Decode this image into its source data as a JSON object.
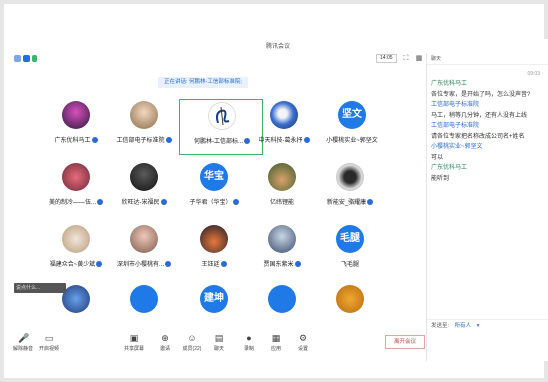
{
  "window": {
    "title": "腾讯会议"
  },
  "topbar": {
    "time": "14:05"
  },
  "speaker": {
    "text": "正在讲话: 何鹏林-工信部标准院;"
  },
  "participants": [
    {
      "name": "广东优科马工",
      "avatar": "photo-tower"
    },
    {
      "name": "工信部电子标准院",
      "avatar": "photo-child"
    },
    {
      "name": "何鹏林-工信部标...",
      "avatar": "photo-logo"
    },
    {
      "name": "中天科技-葛永抒",
      "avatar": "photo-earth"
    },
    {
      "name": "小樱桃实业~郭坚文",
      "avatar_text": "坚文"
    },
    {
      "name": "美的制冷——伍...",
      "avatar": "photo-floral"
    },
    {
      "name": "欣旺达-宋福民",
      "avatar": "photo-dark"
    },
    {
      "name": "子华君（华宝）",
      "avatar_text": "华宝"
    },
    {
      "name": "亿纬锂能",
      "avatar": "photo-landscape"
    },
    {
      "name": "新能安_骆耀康",
      "avatar": "photo-cup"
    },
    {
      "name": "福建众合~黄少斌",
      "avatar": "photo-cartoon"
    },
    {
      "name": "深圳市小樱桃有...",
      "avatar": "photo-girl"
    },
    {
      "name": "王钰廷",
      "avatar": "photo-city"
    },
    {
      "name": "贾国东紫米",
      "avatar": "photo-man"
    },
    {
      "name": "飞毛腿",
      "avatar_text": "毛腿"
    },
    {
      "name": "",
      "avatar": "photo-blue"
    },
    {
      "name": "",
      "avatar": "photo-plain"
    },
    {
      "name": "",
      "avatar_text": "建坤"
    },
    {
      "name": "",
      "avatar": "photo-plain2"
    },
    {
      "name": "",
      "avatar": "photo-orange"
    }
  ],
  "self_bar": {
    "text": "说点什么..."
  },
  "chat": {
    "title": "聊天",
    "time": "09:03",
    "messages": [
      {
        "sender": "广东优科马工",
        "text": "各位专家，是开始了吗，怎么没声音?"
      },
      {
        "sender": "工信部电子标准院",
        "text": "马工，稍等几分钟，还有人没有上线"
      },
      {
        "sender": "工信部电子标准院",
        "text": "请各位专家把名称改成公司名+姓名"
      },
      {
        "sender": "小樱桃实业~郭坚文",
        "text": "可以"
      },
      {
        "sender": "广东优科马工",
        "text": "能听到"
      }
    ],
    "send_to_label": "发送至:",
    "send_to_value": "所有人"
  },
  "toolbar": {
    "mute": "解除静音",
    "video": "开启视频",
    "share": "共享屏幕",
    "invite": "邀请",
    "members": "成员(22)",
    "chat": "聊天",
    "record": "录制",
    "apps": "应用",
    "settings": "设置",
    "leave": "离开会议"
  },
  "colors": {
    "accent": "#1f7ae8",
    "leave": "#d0453a",
    "active_border": "#3bb36b"
  }
}
